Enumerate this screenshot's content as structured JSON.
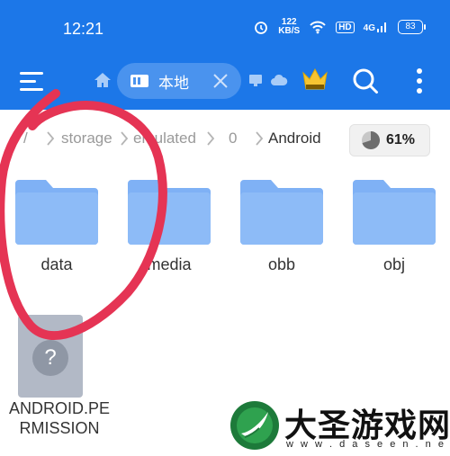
{
  "status_bar": {
    "time": "12:21",
    "speed_value": "122",
    "speed_unit": "KB/S",
    "hd": "HD",
    "network": "4G",
    "battery": "83"
  },
  "toolbar": {
    "tab_label": "本地"
  },
  "breadcrumb": {
    "items": [
      "/",
      "storage",
      "emulated",
      "0",
      "Android"
    ],
    "storage_percent": "61%"
  },
  "folders": [
    {
      "name": "data"
    },
    {
      "name": "media"
    },
    {
      "name": "obb"
    },
    {
      "name": "obj"
    }
  ],
  "files": [
    {
      "name": "ANDROID.PERMISSION",
      "thumb_glyph": "?"
    }
  ],
  "watermark": {
    "title": "大圣游戏网",
    "url": "w w w . d a s e e n . n e t"
  },
  "colors": {
    "accent": "#1c77e8",
    "folder": "#7fb1f5",
    "annotation": "#e53454"
  }
}
